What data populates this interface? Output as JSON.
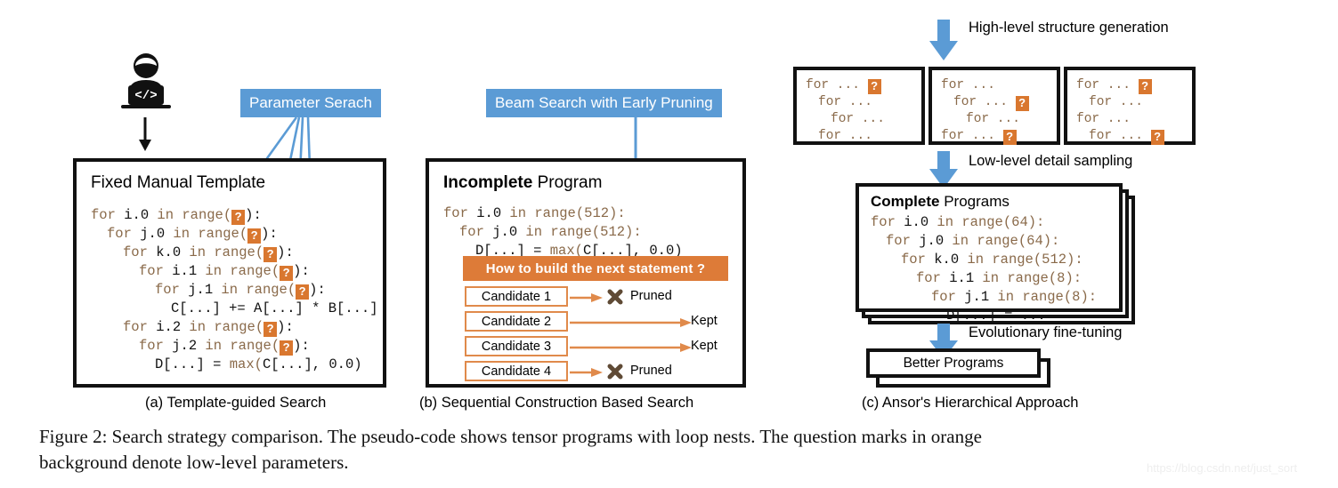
{
  "figure": {
    "caption_line1": "Figure 2: Search strategy comparison. The pseudo-code shows tensor programs with loop nests. The question marks in orange",
    "caption_line2": "background denote low-level parameters.",
    "watermark": "https://blog.csdn.net/just_sort"
  },
  "colors": {
    "orange": "#D9772F",
    "orange_banner": "#DD7B38",
    "orange_border": "#E08A4B",
    "blue": "#5B9BD5",
    "code_keyword": "#8a6a4a",
    "frame": "#111111",
    "cross": "#5f4a35"
  },
  "panel_a": {
    "sub_caption": "(a) Template-guided Search",
    "callout_label": "Parameter Serach",
    "developer_icon": "developer-at-laptop-icon",
    "box_title": "Fixed Manual Template",
    "code": [
      {
        "indent": 0,
        "segments": [
          {
            "t": "for ",
            "k": true
          },
          {
            "t": "i.0",
            "k": false
          },
          {
            "t": " in ",
            "k": true
          },
          {
            "t": "range(",
            "k": true
          },
          {
            "t": "?",
            "q": true
          },
          {
            "t": "):",
            "k": false
          }
        ]
      },
      {
        "indent": 1,
        "segments": [
          {
            "t": "for ",
            "k": true
          },
          {
            "t": "j.0",
            "k": false
          },
          {
            "t": " in ",
            "k": true
          },
          {
            "t": "range(",
            "k": true
          },
          {
            "t": "?",
            "q": true
          },
          {
            "t": "):",
            "k": false
          }
        ]
      },
      {
        "indent": 2,
        "segments": [
          {
            "t": "for ",
            "k": true
          },
          {
            "t": "k.0",
            "k": false
          },
          {
            "t": " in ",
            "k": true
          },
          {
            "t": "range(",
            "k": true
          },
          {
            "t": "?",
            "q": true
          },
          {
            "t": "):",
            "k": false
          }
        ]
      },
      {
        "indent": 3,
        "segments": [
          {
            "t": "for ",
            "k": true
          },
          {
            "t": "i.1",
            "k": false
          },
          {
            "t": " in ",
            "k": true
          },
          {
            "t": "range(",
            "k": true
          },
          {
            "t": "?",
            "q": true
          },
          {
            "t": "):",
            "k": false
          }
        ]
      },
      {
        "indent": 4,
        "segments": [
          {
            "t": "for ",
            "k": true
          },
          {
            "t": "j.1",
            "k": false
          },
          {
            "t": " in ",
            "k": true
          },
          {
            "t": "range(",
            "k": true
          },
          {
            "t": "?",
            "q": true
          },
          {
            "t": "):",
            "k": false
          }
        ]
      },
      {
        "indent": 5,
        "segments": [
          {
            "t": "C[...] += A[...] * B[...]",
            "k": false
          }
        ]
      },
      {
        "indent": 2,
        "segments": [
          {
            "t": "for ",
            "k": true
          },
          {
            "t": "i.2",
            "k": false
          },
          {
            "t": " in ",
            "k": true
          },
          {
            "t": "range(",
            "k": true
          },
          {
            "t": "?",
            "q": true
          },
          {
            "t": "):",
            "k": false
          }
        ]
      },
      {
        "indent": 3,
        "segments": [
          {
            "t": "for ",
            "k": true
          },
          {
            "t": "j.2",
            "k": false
          },
          {
            "t": " in ",
            "k": true
          },
          {
            "t": "range(",
            "k": true
          },
          {
            "t": "?",
            "q": true
          },
          {
            "t": "):",
            "k": false
          }
        ]
      },
      {
        "indent": 4,
        "segments": [
          {
            "t": "D[...] = ",
            "k": false
          },
          {
            "t": "max(",
            "k": true
          },
          {
            "t": "C[...], 0.0)",
            "k": false
          }
        ]
      }
    ]
  },
  "panel_b": {
    "sub_caption": "(b) Sequential Construction Based Search",
    "callout_label": "Beam Search with Early Pruning",
    "box_title_bold": "Incomplete",
    "box_title_rest": " Program",
    "code": [
      {
        "indent": 0,
        "segments": [
          {
            "t": "for ",
            "k": true
          },
          {
            "t": "i.0",
            "k": false
          },
          {
            "t": " in ",
            "k": true
          },
          {
            "t": "range(512):",
            "k": true
          }
        ]
      },
      {
        "indent": 1,
        "segments": [
          {
            "t": "for ",
            "k": true
          },
          {
            "t": "j.0",
            "k": false
          },
          {
            "t": " in ",
            "k": true
          },
          {
            "t": "range(512):",
            "k": true
          }
        ]
      },
      {
        "indent": 2,
        "segments": [
          {
            "t": "D[...] = ",
            "k": false
          },
          {
            "t": "max(",
            "k": true
          },
          {
            "t": "C[...], 0.0)",
            "k": false
          }
        ]
      }
    ],
    "banner": "How to build the next statement ?",
    "candidates": [
      {
        "label": "Candidate 1",
        "outcome": "Pruned",
        "pruned": true
      },
      {
        "label": "Candidate 2",
        "outcome": "Kept",
        "pruned": false
      },
      {
        "label": "Candidate 3",
        "outcome": "Kept",
        "pruned": false
      },
      {
        "label": "Candidate 4",
        "outcome": "Pruned",
        "pruned": true
      }
    ]
  },
  "panel_c": {
    "sub_caption": "(c) Ansor's Hierarchical Approach",
    "step1_label": "High-level structure generation",
    "step2_label": "Low-level detail sampling",
    "step3_label": "Evolutionary fine-tuning",
    "sketches": [
      {
        "lines": [
          {
            "indent": 0,
            "text": "for ...",
            "q": true
          },
          {
            "indent": 1,
            "text": "for ...",
            "q": false
          },
          {
            "indent": 2,
            "text": "for ...",
            "q": false
          },
          {
            "indent": 1,
            "text": "for ...",
            "q": false
          }
        ]
      },
      {
        "lines": [
          {
            "indent": 0,
            "text": "for ...",
            "q": false
          },
          {
            "indent": 1,
            "text": "for ...",
            "q": true
          },
          {
            "indent": 2,
            "text": "for ...",
            "q": false
          },
          {
            "indent": 0,
            "text": "for ...",
            "q": true
          }
        ]
      },
      {
        "lines": [
          {
            "indent": 0,
            "text": "for ...",
            "q": true
          },
          {
            "indent": 1,
            "text": "for ...",
            "q": false
          },
          {
            "indent": 0,
            "text": "for ...",
            "q": false
          },
          {
            "indent": 1,
            "text": "for ...",
            "q": true
          }
        ]
      }
    ],
    "complete_title_bold": "Complete",
    "complete_title_rest": " Programs",
    "complete_code": [
      {
        "indent": 0,
        "segments": [
          {
            "t": "for ",
            "k": true
          },
          {
            "t": "i.0",
            "k": false
          },
          {
            "t": " in ",
            "k": true
          },
          {
            "t": "range(64):",
            "k": true
          }
        ]
      },
      {
        "indent": 1,
        "segments": [
          {
            "t": "for ",
            "k": true
          },
          {
            "t": "j.0",
            "k": false
          },
          {
            "t": " in ",
            "k": true
          },
          {
            "t": "range(64):",
            "k": true
          }
        ]
      },
      {
        "indent": 2,
        "segments": [
          {
            "t": "for ",
            "k": true
          },
          {
            "t": "k.0",
            "k": false
          },
          {
            "t": " in ",
            "k": true
          },
          {
            "t": "range(512):",
            "k": true
          }
        ]
      },
      {
        "indent": 3,
        "segments": [
          {
            "t": "for ",
            "k": true
          },
          {
            "t": "i.1",
            "k": false
          },
          {
            "t": " in ",
            "k": true
          },
          {
            "t": "range(8):",
            "k": true
          }
        ]
      },
      {
        "indent": 4,
        "segments": [
          {
            "t": "for ",
            "k": true
          },
          {
            "t": "j.1",
            "k": false
          },
          {
            "t": " in ",
            "k": true
          },
          {
            "t": "range(8):",
            "k": true
          }
        ]
      },
      {
        "indent": 5,
        "segments": [
          {
            "t": "D[...] = ...",
            "k": false
          }
        ]
      }
    ],
    "better_programs": "Better Programs"
  }
}
